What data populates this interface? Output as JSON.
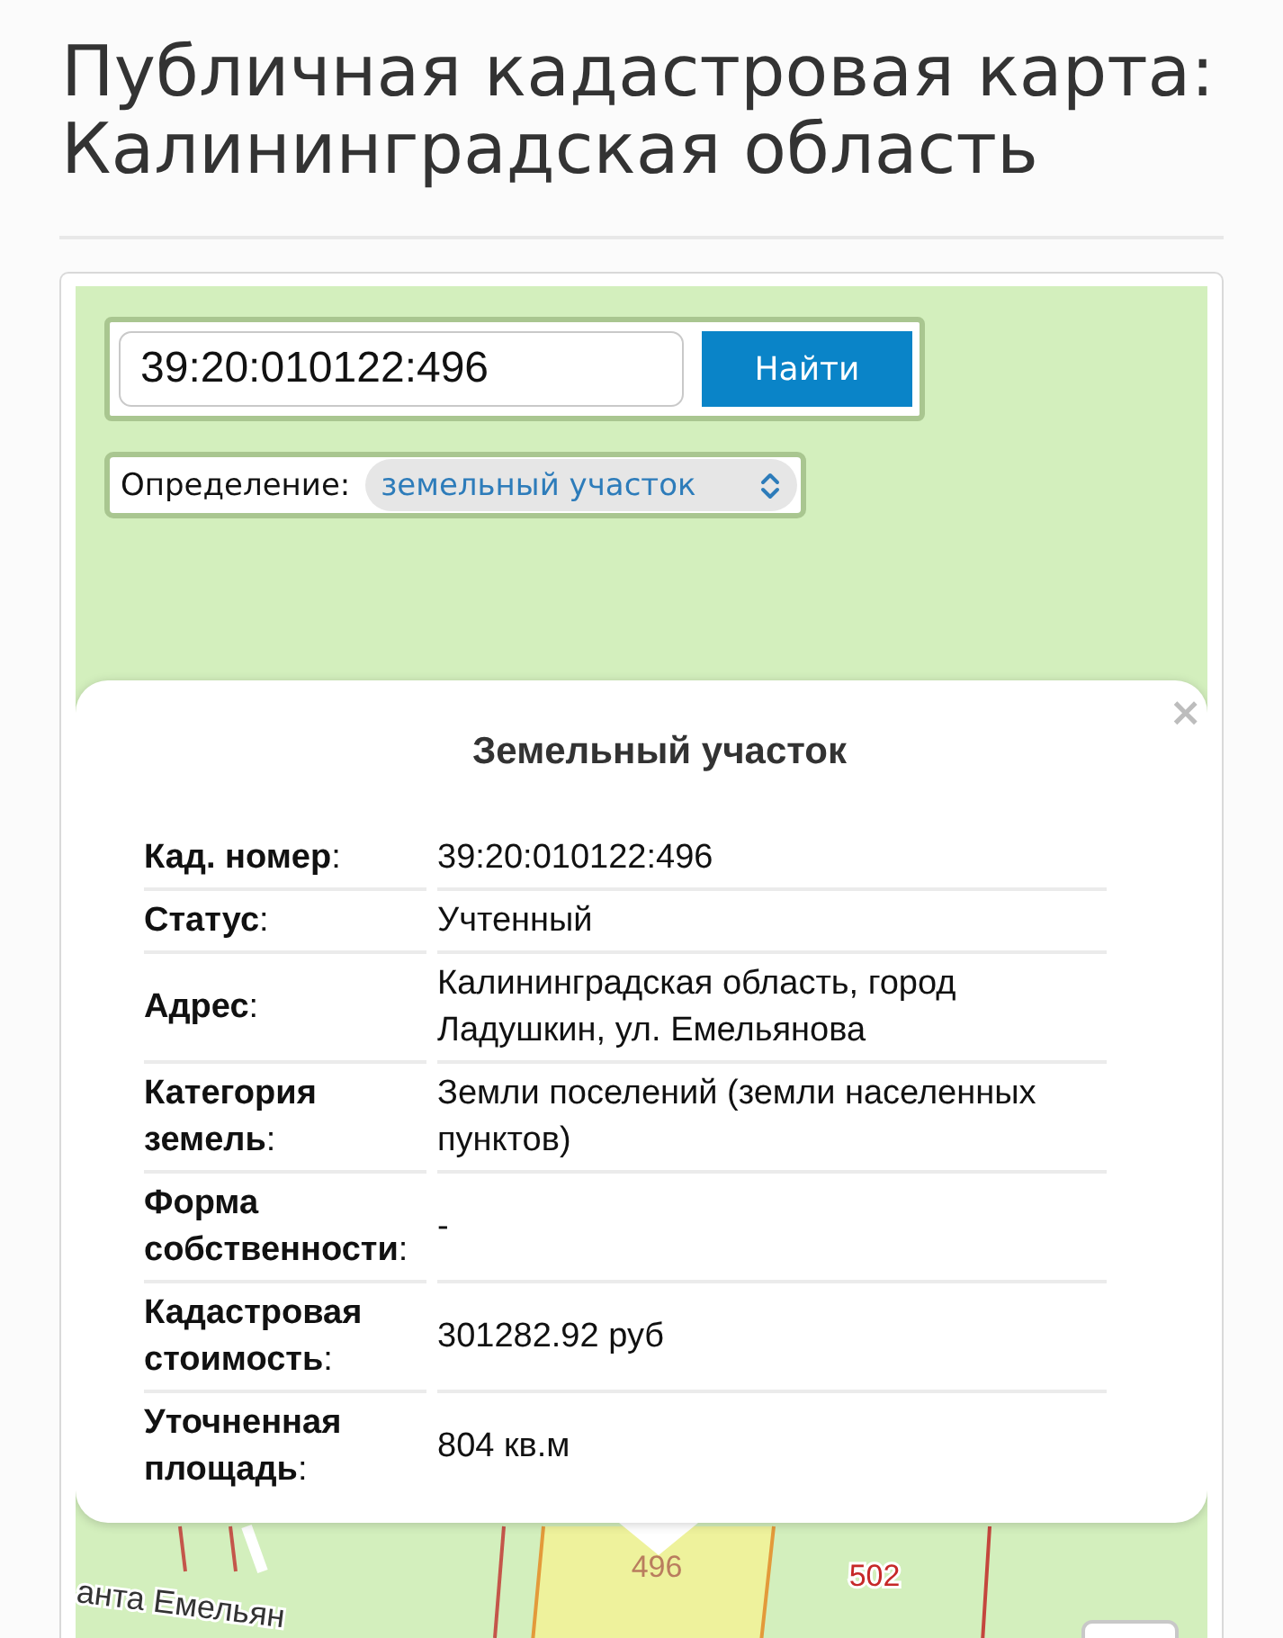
{
  "title": "Публичная кадастровая карта: Калининградская область",
  "search": {
    "value": "39:20:010122:496",
    "button": "Найти"
  },
  "definition": {
    "label": "Определение:",
    "value": "земельный участок"
  },
  "popup": {
    "title": "Земельный участок",
    "close": "×",
    "rows": [
      {
        "label": "**Кад. номер**:",
        "value": "39:20:010122:496"
      },
      {
        "label": "**Статус**:",
        "value": "Учтенный"
      },
      {
        "label": "**Адрес**:",
        "value": "Калининградская область, город Ладушкин, ул. Емельянова"
      },
      {
        "label": "**Категория земель**:",
        "value": "Земли поселений (земли населенных пунктов)"
      },
      {
        "label": "**Форма собственности**:",
        "value": "-"
      },
      {
        "label": "**Кадастровая стоимость**:",
        "value": "301282.92 руб"
      },
      {
        "label": "**Уточненная площадь**:",
        "value": "804 кв.м"
      }
    ]
  },
  "map": {
    "parcels": [
      {
        "label": "496",
        "selected": true
      },
      {
        "label": "502",
        "selected": false
      }
    ],
    "street_label": "анта Емельян"
  }
}
